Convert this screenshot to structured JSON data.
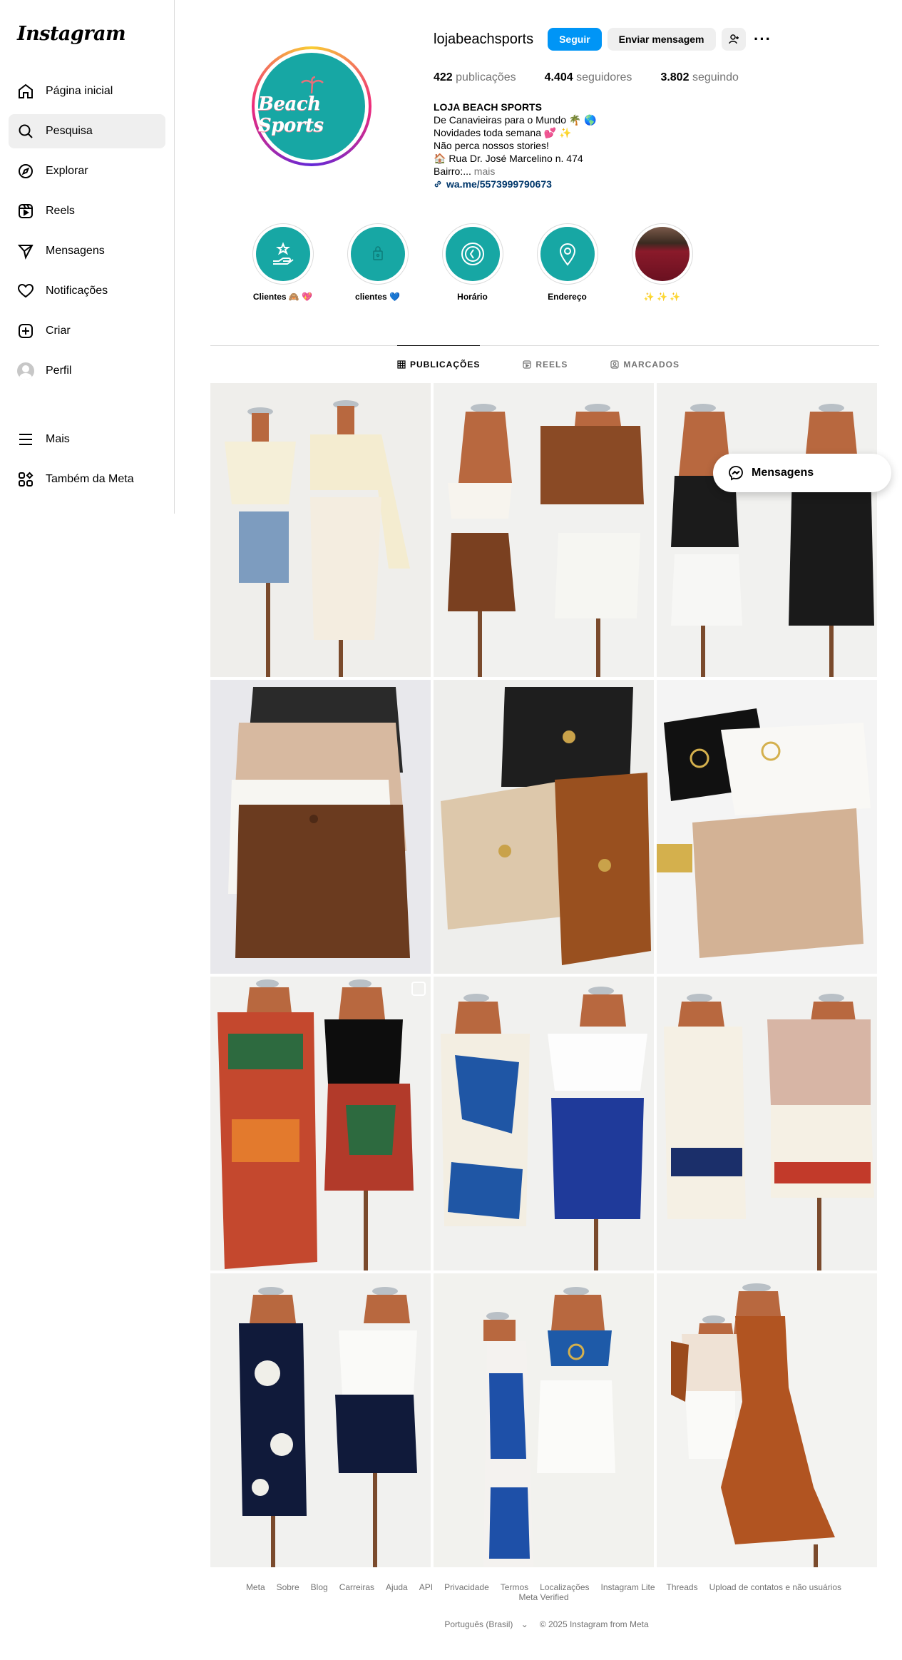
{
  "app": {
    "logo": "Instagram"
  },
  "sidebar": {
    "items": [
      {
        "label": "Página inicial",
        "icon": "home-icon"
      },
      {
        "label": "Pesquisa",
        "icon": "search-icon",
        "active": true
      },
      {
        "label": "Explorar",
        "icon": "compass-icon"
      },
      {
        "label": "Reels",
        "icon": "reels-icon"
      },
      {
        "label": "Mensagens",
        "icon": "send-icon"
      },
      {
        "label": "Notificações",
        "icon": "heart-icon"
      },
      {
        "label": "Criar",
        "icon": "plus-square-icon"
      },
      {
        "label": "Perfil",
        "icon": "avatar"
      }
    ],
    "bottom": [
      {
        "label": "Mais",
        "icon": "menu-icon"
      },
      {
        "label": "Também da Meta",
        "icon": "meta-apps-icon"
      }
    ]
  },
  "profile": {
    "username": "lojabeachsports",
    "pic_text": "Beach Sports",
    "follow_label": "Seguir",
    "message_label": "Enviar mensagem",
    "stats": {
      "posts_count": "422",
      "posts_label": "publicações",
      "followers_count": "4.404",
      "followers_label": "seguidores",
      "following_count": "3.802",
      "following_label": "seguindo"
    },
    "bio": {
      "name": "LOJA BEACH SPORTS",
      "line1": "De Canavieiras para o Mundo 🌴 🌎",
      "line2": "Novidades toda semana 💕 ✨",
      "line3": "Não perca nossos stories!",
      "line4": "🏠 Rua Dr. José Marcelino n. 474",
      "line5": "Bairro:...",
      "more": "mais",
      "link": "wa.me/5573999790673"
    }
  },
  "highlights": [
    {
      "label": "Clientes 🙈 💖",
      "icon": "hand-star-icon"
    },
    {
      "label": "clientes 💙",
      "icon": "bag-icon"
    },
    {
      "label": "Horário",
      "icon": "clock-icon"
    },
    {
      "label": "Endereço",
      "icon": "pin-icon"
    },
    {
      "label": "✨ ✨ ✨",
      "icon": "photo"
    }
  ],
  "tabs": [
    {
      "label": "PUBLICAÇÕES",
      "active": true
    },
    {
      "label": "REELS"
    },
    {
      "label": "MARCADOS"
    }
  ],
  "posts_count_visible": 12,
  "floating_messages": {
    "label": "Mensagens"
  },
  "footer": {
    "links": [
      "Meta",
      "Sobre",
      "Blog",
      "Carreiras",
      "Ajuda",
      "API",
      "Privacidade",
      "Termos",
      "Localizações",
      "Instagram Lite",
      "Threads",
      "Upload de contatos e não usuários",
      "Meta Verified"
    ],
    "language": "Português (Brasil)",
    "copyright": "© 2025 Instagram from Meta"
  },
  "colors": {
    "accent": "#0095f6",
    "brand_teal": "#17a7a4",
    "link": "#00376b"
  }
}
